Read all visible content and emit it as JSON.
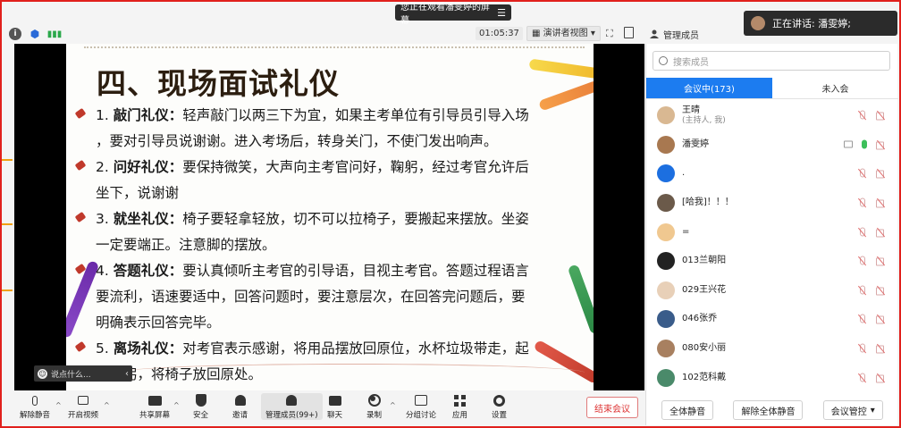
{
  "share_notice": {
    "text": "您正在观看潘雯婷的屏幕",
    "menu_glyph": "☰"
  },
  "speaking": {
    "text": "正在讲话: 潘雯婷;"
  },
  "top_bar": {
    "timer": "01:05:37",
    "view_label": "演讲者视图",
    "view_caret": "▾",
    "fullscreen_glyph": "⛶"
  },
  "members_header": {
    "title": "管理成员"
  },
  "slide": {
    "title": "四、现场面试礼仪",
    "lines": [
      {
        "prefix": "1. ",
        "bold": "敲门礼仪：",
        "text": "轻声敲门以两三下为宜，如果主考单位有引导员引导入场"
      },
      {
        "prefix": "",
        "bold": "",
        "text": "，要对引导员说谢谢。进入考场后，转身关门，不使门发出响声。"
      },
      {
        "prefix": "2. ",
        "bold": "问好礼仪：",
        "text": "要保持微笑，大声向主考官问好，鞠躬，经过考官允许后"
      },
      {
        "prefix": "",
        "bold": "",
        "text": "坐下，说谢谢"
      },
      {
        "prefix": "3. ",
        "bold": "就坐礼仪：",
        "text": "椅子要轻拿轻放，切不可以拉椅子，要搬起来摆放。坐姿"
      },
      {
        "prefix": "",
        "bold": "",
        "text": "一定要端正。注意脚的摆放。"
      },
      {
        "prefix": "4. ",
        "bold": "答题礼仪：",
        "text": "要认真倾听主考官的引导语，目视主考官。答题过程语言"
      },
      {
        "prefix": "",
        "bold": "",
        "text": "要流利，语速要适中，回答问题时，要注意层次，在回答完问题后，要"
      },
      {
        "prefix": "",
        "bold": "",
        "text": "明确表示回答完毕。"
      },
      {
        "prefix": "5. ",
        "bold": "离场礼仪：",
        "text": "对考官表示感谢，将用品摆放回原位，水杯垃圾带走，起"
      },
      {
        "prefix": "",
        "bold": "",
        "text": "立鞠躬，将椅子放回原处。"
      }
    ]
  },
  "comment_box": {
    "placeholder": "说点什么...",
    "chevron": "‹"
  },
  "collapse_arrow": "‹",
  "panel": {
    "search_placeholder": "搜索成员",
    "tabs": [
      {
        "label": "会议中(173)",
        "active": true
      },
      {
        "label": "未入会",
        "active": false
      }
    ],
    "members": [
      {
        "name": "王晴",
        "sub": "(主持人, 我)",
        "avatar_color": "#d9b892",
        "mic_on": false,
        "screen": false
      },
      {
        "name": "潘雯婷",
        "sub": "",
        "avatar_color": "#a87850",
        "mic_on": true,
        "screen": true
      },
      {
        "name": ".",
        "sub": "",
        "avatar_color": "#1c6fe0",
        "mic_on": false,
        "screen": false
      },
      {
        "name": "[哈我]！！！",
        "sub": "",
        "avatar_color": "#6b5a4a",
        "mic_on": false,
        "screen": false
      },
      {
        "name": "=",
        "sub": "",
        "avatar_color": "#f0c890",
        "mic_on": false,
        "screen": false
      },
      {
        "name": "013兰朝阳",
        "sub": "",
        "avatar_color": "#222222",
        "mic_on": false,
        "screen": false
      },
      {
        "name": "029王兴花",
        "sub": "",
        "avatar_color": "#e8d0b8",
        "mic_on": false,
        "screen": false
      },
      {
        "name": "046张乔",
        "sub": "",
        "avatar_color": "#3a5c8a",
        "mic_on": false,
        "screen": false
      },
      {
        "name": "080安小丽",
        "sub": "",
        "avatar_color": "#a88060",
        "mic_on": false,
        "screen": false
      },
      {
        "name": "102范科戴",
        "sub": "",
        "avatar_color": "#4a8a6a",
        "mic_on": false,
        "screen": false
      }
    ],
    "buttons": {
      "mute_all": "全体静音",
      "unmute_all": "解除全体静音",
      "manage": "会议管控",
      "manage_caret": "▾"
    }
  },
  "bottom_bar": {
    "unmute": "解除静音",
    "start_video": "开启视频",
    "share_screen": "共享屏幕",
    "security": "安全",
    "invite": "邀请",
    "manage_members": "管理成员(99+)",
    "chat": "聊天",
    "record": "录制",
    "breakout": "分组讨论",
    "apps": "应用",
    "settings": "设置",
    "end_meeting": "结束会议",
    "caret": "^"
  },
  "colors": {
    "accent": "#1c7cf0",
    "frame_border": "#e0201c",
    "end_button": "#d33333"
  }
}
